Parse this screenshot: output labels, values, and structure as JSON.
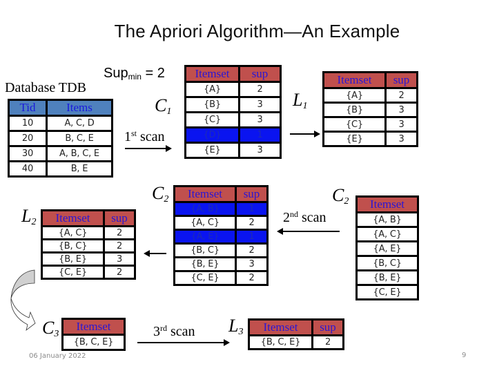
{
  "title": "The Apriori Algorithm—An Example",
  "sup_min": {
    "label": "Sup",
    "sub": "min",
    "value": "= 2"
  },
  "database": {
    "title": "Database TDB",
    "headers": [
      "Tid",
      "Items"
    ],
    "rows": [
      [
        "10",
        "A, C, D"
      ],
      [
        "20",
        "B, C, E"
      ],
      [
        "30",
        "A, B, C, E"
      ],
      [
        "40",
        "B, E"
      ]
    ]
  },
  "labels": {
    "c1": {
      "main": "C",
      "sub": "1"
    },
    "l1": {
      "main": "L",
      "sub": "1"
    },
    "c2": {
      "main": "C",
      "sub": "2"
    },
    "c2_right": {
      "main": "C",
      "sub": "2"
    },
    "l2": {
      "main": "L",
      "sub": "2"
    },
    "c3": {
      "main": "C",
      "sub": "3"
    },
    "l3": {
      "main": "L",
      "sub": "3"
    }
  },
  "scans": {
    "first": {
      "num": "1",
      "suffix": "st",
      "word": "scan"
    },
    "second": {
      "num": "2",
      "suffix": "nd",
      "word": "scan"
    },
    "third": {
      "num": "3",
      "suffix": "rd",
      "word": "scan"
    }
  },
  "colors": {
    "header_red": "#c0504d",
    "header_blue": "#4f81bd",
    "pruned_row": "#0a14f0",
    "header_text": "#2a16d4"
  },
  "tables": {
    "c1": {
      "headers": [
        "Itemset",
        "sup"
      ],
      "rows": [
        {
          "itemset": "{A}",
          "sup": "2",
          "pruned": false
        },
        {
          "itemset": "{B}",
          "sup": "3",
          "pruned": false
        },
        {
          "itemset": "{C}",
          "sup": "3",
          "pruned": false
        },
        {
          "itemset": "{D}",
          "sup": "1",
          "pruned": true
        },
        {
          "itemset": "{E}",
          "sup": "3",
          "pruned": false
        }
      ]
    },
    "l1": {
      "headers": [
        "Itemset",
        "sup"
      ],
      "rows": [
        {
          "itemset": "{A}",
          "sup": "2"
        },
        {
          "itemset": "{B}",
          "sup": "3"
        },
        {
          "itemset": "{C}",
          "sup": "3"
        },
        {
          "itemset": "{E}",
          "sup": "3"
        }
      ]
    },
    "c2_counted": {
      "headers": [
        "Itemset",
        "sup"
      ],
      "rows": [
        {
          "itemset": "{A, B}",
          "sup": "1",
          "pruned": true
        },
        {
          "itemset": "{A, C}",
          "sup": "2",
          "pruned": false
        },
        {
          "itemset": "{A, E}",
          "sup": "1",
          "pruned": true
        },
        {
          "itemset": "{B, C}",
          "sup": "2",
          "pruned": false
        },
        {
          "itemset": "{B, E}",
          "sup": "3",
          "pruned": false
        },
        {
          "itemset": "{C, E}",
          "sup": "2",
          "pruned": false
        }
      ]
    },
    "c2_candidates": {
      "headers": [
        "Itemset"
      ],
      "rows": [
        "{A, B}",
        "{A, C}",
        "{A, E}",
        "{B, C}",
        "{B, E}",
        "{C, E}"
      ]
    },
    "l2": {
      "headers": [
        "Itemset",
        "sup"
      ],
      "rows": [
        {
          "itemset": "{A, C}",
          "sup": "2"
        },
        {
          "itemset": "{B, C}",
          "sup": "2"
        },
        {
          "itemset": "{B, E}",
          "sup": "3"
        },
        {
          "itemset": "{C, E}",
          "sup": "2"
        }
      ]
    },
    "c3": {
      "headers": [
        "Itemset"
      ],
      "rows": [
        "{B, C, E}"
      ]
    },
    "l3": {
      "headers": [
        "Itemset",
        "sup"
      ],
      "rows": [
        {
          "itemset": "{B, C, E}",
          "sup": "2"
        }
      ]
    }
  },
  "footer": {
    "date": "06 January 2022",
    "page_number": "9"
  }
}
